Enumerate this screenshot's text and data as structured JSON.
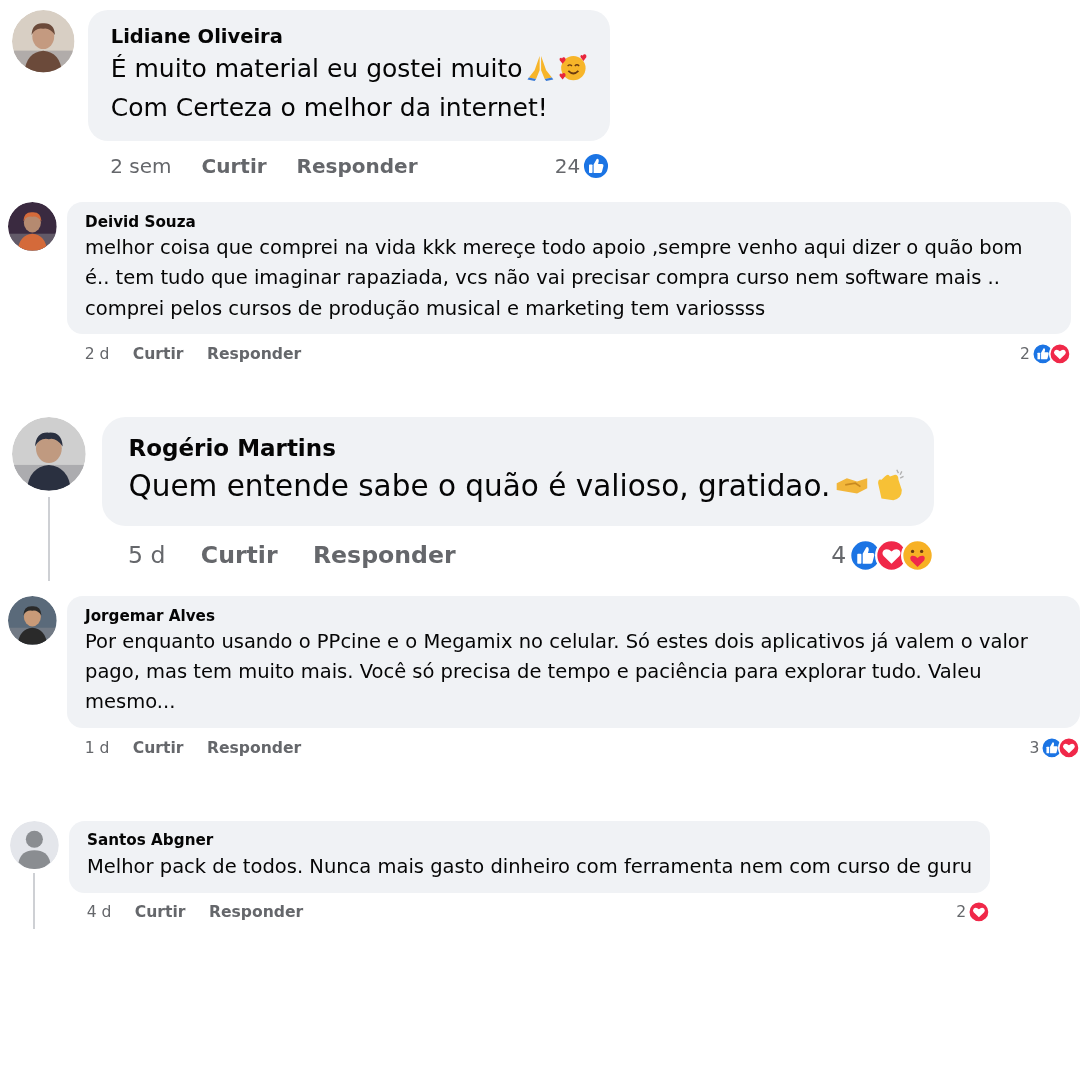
{
  "comments": [
    {
      "author": "Lidiane Oliveira",
      "avatar": {
        "kind": "picture"
      },
      "paragraphs": [
        "É muito material eu gostei muito",
        "Com Certeza o melhor da internet!"
      ],
      "time": "2 sem",
      "actions": [
        "Curtir",
        "Responder"
      ],
      "reaction_count": "24",
      "reactions": [
        {
          "kind": "like"
        }
      ],
      "thread_line": false
    },
    {
      "author": "Deivid Souza",
      "avatar": {
        "kind": "picture"
      },
      "paragraphs": [
        "melhor coisa que comprei na vida kkk mereçe todo apoio ,sempre venho aqui dizer o quão bom é.. tem tudo que imaginar rapaziada, vcs não vai precisar compra curso nem software mais .. comprei pelos cursos de produção musical e marketing tem variossss"
      ],
      "time": "2 d",
      "actions": [
        "Curtir",
        "Responder"
      ],
      "reaction_count": "2",
      "reactions": [
        {
          "kind": "like"
        },
        {
          "kind": "love"
        }
      ],
      "thread_line": false
    },
    {
      "author": "Rogério Martins",
      "avatar": {
        "kind": "picture"
      },
      "paragraphs": [
        "Quem entende sabe o quão é valioso, gratidao."
      ],
      "time": "5 d",
      "actions": [
        "Curtir",
        "Responder"
      ],
      "reaction_count": "4",
      "reactions": [
        {
          "kind": "like"
        },
        {
          "kind": "love"
        },
        {
          "kind": "care"
        }
      ],
      "thread_line": true
    },
    {
      "author": "Jorgemar Alves",
      "avatar": {
        "kind": "picture"
      },
      "paragraphs": [
        "Por enquanto usando o PPcine e o Megamix no celular. Só estes dois aplicativos já valem o valor pago, mas tem muito mais. Você só precisa de tempo e paciência para explorar tudo. Valeu mesmo..."
      ],
      "time": "1 d",
      "actions": [
        "Curtir",
        "Responder"
      ],
      "reaction_count": "3",
      "reactions": [
        {
          "kind": "like"
        },
        {
          "kind": "love"
        }
      ],
      "thread_line": false
    },
    {
      "author": "Santos Abgner",
      "avatar": {
        "kind": "default"
      },
      "paragraphs": [
        "Melhor pack de todos. Nunca mais gasto dinheiro com ferramenta nem com curso de guru"
      ],
      "time": "4 d",
      "actions": [
        "Curtir",
        "Responder"
      ],
      "reaction_count": "2",
      "reactions": [
        {
          "kind": "love"
        }
      ],
      "thread_line": true
    }
  ]
}
